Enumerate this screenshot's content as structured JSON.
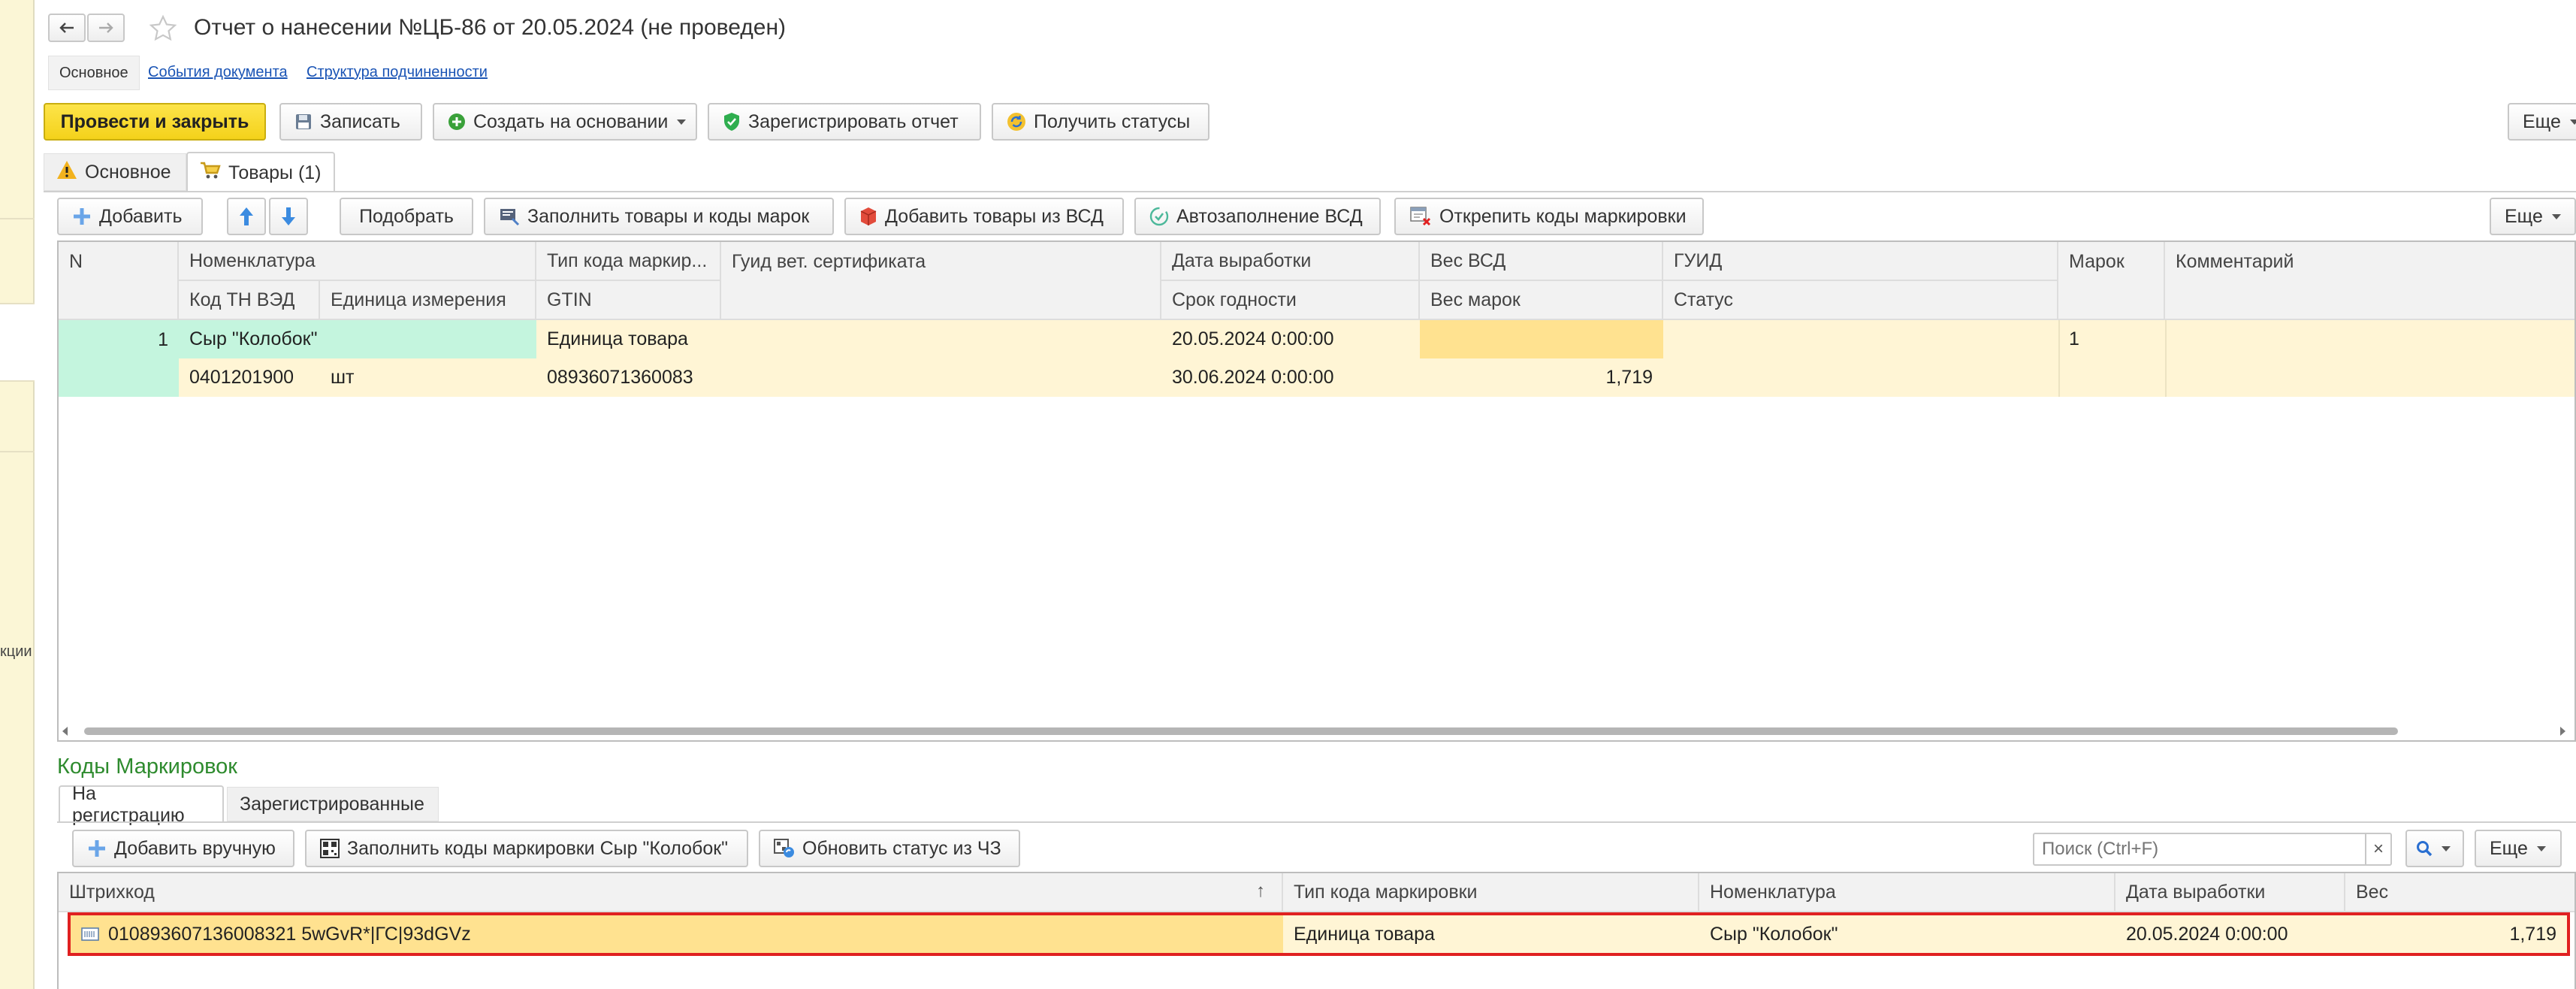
{
  "window": {
    "title": "Отчет о нанесении №ЦБ-86 от 20.05.2024 (не проведен)",
    "back_icon": "arrow-left",
    "forward_icon": "arrow-right",
    "favorite_icon": "star-outline"
  },
  "side_panel": {
    "label": "кции"
  },
  "nav_links": {
    "main": "Основное",
    "events": "События документа",
    "structure": "Структура подчиненности"
  },
  "toolbar": {
    "post_close": "Провести и закрыть",
    "save": "Записать",
    "create_based": "Создать на основании",
    "register_report": "Зарегистрировать отчет",
    "get_statuses": "Получить статусы",
    "more": "Еще"
  },
  "page_tabs": {
    "main": "Основное",
    "goods": "Товары (1)"
  },
  "goods_toolbar": {
    "add": "Добавить",
    "pick": "Подобрать",
    "fill_goods_codes": "Заполнить товары и коды марок",
    "add_from_vsd": "Добавить товары из ВСД",
    "autofill_vsd": "Автозаполнение ВСД",
    "detach_codes": "Открепить коды маркировки",
    "more": "Еще"
  },
  "goods_table": {
    "headers": {
      "n": "N",
      "nomenclature": "Номенклатура",
      "tnved": "Код ТН ВЭД",
      "unit": "Единица измерения",
      "code_type": "Тип кода маркир...",
      "gtin": "GTIN",
      "vet_guid": "Гуид вет. сертификата",
      "prod_date": "Дата выработки",
      "expiry": "Срок годности",
      "vsd_weight": "Вес ВСД",
      "marks_weight": "Вес марок",
      "guid": "ГУИД",
      "status": "Статус",
      "marks": "Марок",
      "comment": "Комментарий"
    },
    "row": {
      "n": "1",
      "nomenclature": "Сыр \"Колобок\"",
      "tnved": "0401201900",
      "unit": "шт",
      "code_type": "Единица товара",
      "gtin": "08936071360083",
      "vet_guid": "",
      "prod_date": "20.05.2024 0:00:00",
      "expiry": "30.06.2024 0:00:00",
      "vsd_weight": "",
      "marks_weight": "1,719",
      "guid": "",
      "status": "",
      "marks": "1",
      "comment": ""
    }
  },
  "marking_section": {
    "title": "Коды Маркировок",
    "tab_pending": "На регистрацию",
    "tab_registered": "Зарегистрированные",
    "add_manual": "Добавить вручную",
    "fill_codes": "Заполнить коды маркировки Сыр \"Колобок\"",
    "update_status": "Обновить статус из ЧЗ",
    "search_placeholder": "Поиск (Ctrl+F)",
    "more": "Еще",
    "headers": {
      "barcode": "Штрихкод",
      "code_type": "Тип кода маркировки",
      "nomenclature": "Номенклатура",
      "prod_date": "Дата выработки",
      "weight": "Вес"
    },
    "row": {
      "barcode": "010893607136008321 5wGvR*|ГС|93dGVz",
      "code_type": "Единица товара",
      "nomenclature": "Сыр \"Колобок\"",
      "prod_date": "20.05.2024 0:00:00",
      "weight": "1,719"
    }
  },
  "colors": {
    "accent_yellow": "#f4d21a",
    "selection": "#ffeaa0",
    "row_highlight": "#fff5d5",
    "active_cell": "#c4f5de",
    "section_green": "#2e8b2e",
    "error_border": "#e02020"
  }
}
